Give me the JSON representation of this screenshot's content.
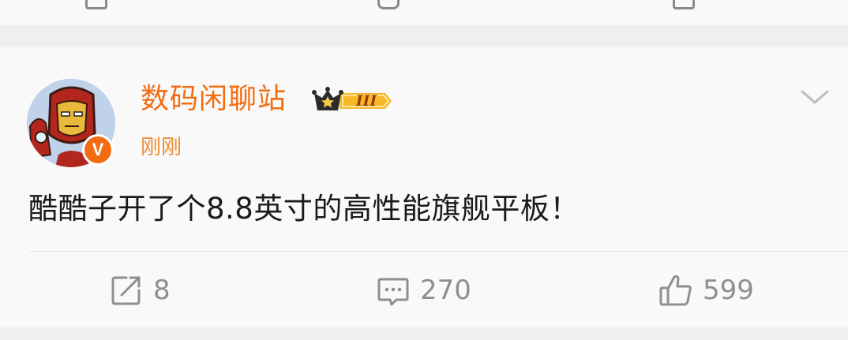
{
  "post": {
    "author": "数码闲聊站",
    "verified_badge": "V",
    "level_badge": "III",
    "timestamp": "刚刚",
    "text": "酷酷子开了个8.8英寸的高性能旗舰平板！"
  },
  "actions": {
    "repost_count": "8",
    "comment_count": "270",
    "like_count": "599"
  },
  "icons": {
    "repost": "share-edit-icon",
    "comment": "comment-icon",
    "like": "thumbs-up-icon",
    "more": "chevron-down-icon",
    "level": "crown-icon"
  },
  "colors": {
    "accent": "#f26d12",
    "timestamp": "#f08a30",
    "badge_gold": "#f6b92b",
    "muted": "#8f8f8f",
    "background": "#efefef",
    "card": "#f9f9f9"
  }
}
